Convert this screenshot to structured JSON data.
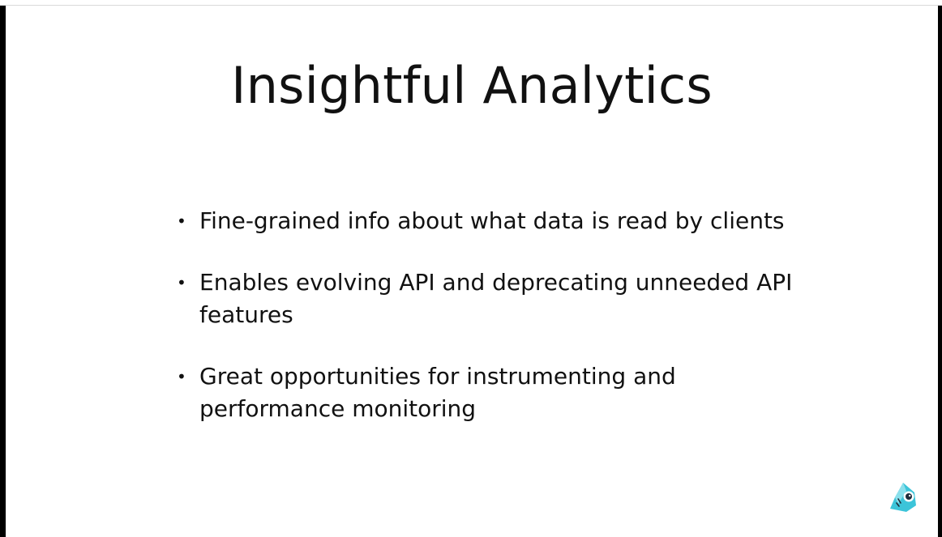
{
  "slide": {
    "title": "Insightful Analytics",
    "bullets": [
      "Fine-grained info about what data is read by clients",
      "Enables evolving API and deprecating unneeded API features",
      "Great opportunities for instrumenting and performance monitoring"
    ],
    "bullet_glyph": "•"
  },
  "logo": {
    "icon": "graphcool-logo-icon",
    "color": "#3cc4d9"
  }
}
